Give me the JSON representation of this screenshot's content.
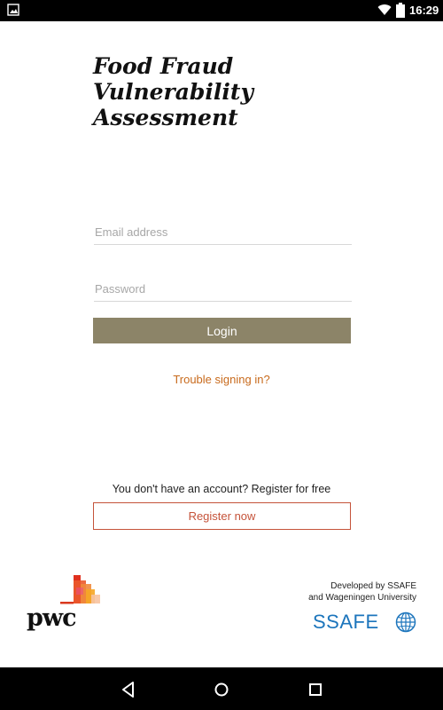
{
  "status_bar": {
    "time": "16:29",
    "icons": [
      "image-notification-icon",
      "wifi-icon",
      "battery-icon"
    ]
  },
  "app": {
    "title_lines": [
      "Food Fraud",
      "Vulnerability",
      "Assessment"
    ]
  },
  "login_form": {
    "email_placeholder": "Email address",
    "email_value": "",
    "password_placeholder": "Password",
    "password_value": "",
    "login_label": "Login",
    "trouble_link": "Trouble signing in?"
  },
  "register": {
    "prompt": "You don't have an account? Register for free",
    "button_label": "Register now"
  },
  "footer": {
    "pwc_logo_text": "pwc",
    "developed_by_lines": [
      "Developed by SSAFE",
      "and Wageningen University"
    ],
    "ssafe_logo_text": "SSAFE"
  },
  "nav_bar": {
    "buttons": [
      "back-icon",
      "home-icon",
      "recents-icon"
    ]
  },
  "colors": {
    "accent_button": "#8c8468",
    "link_orange": "#c86a1c",
    "register_border": "#c5533a",
    "ssafe_blue": "#1c75bc"
  }
}
